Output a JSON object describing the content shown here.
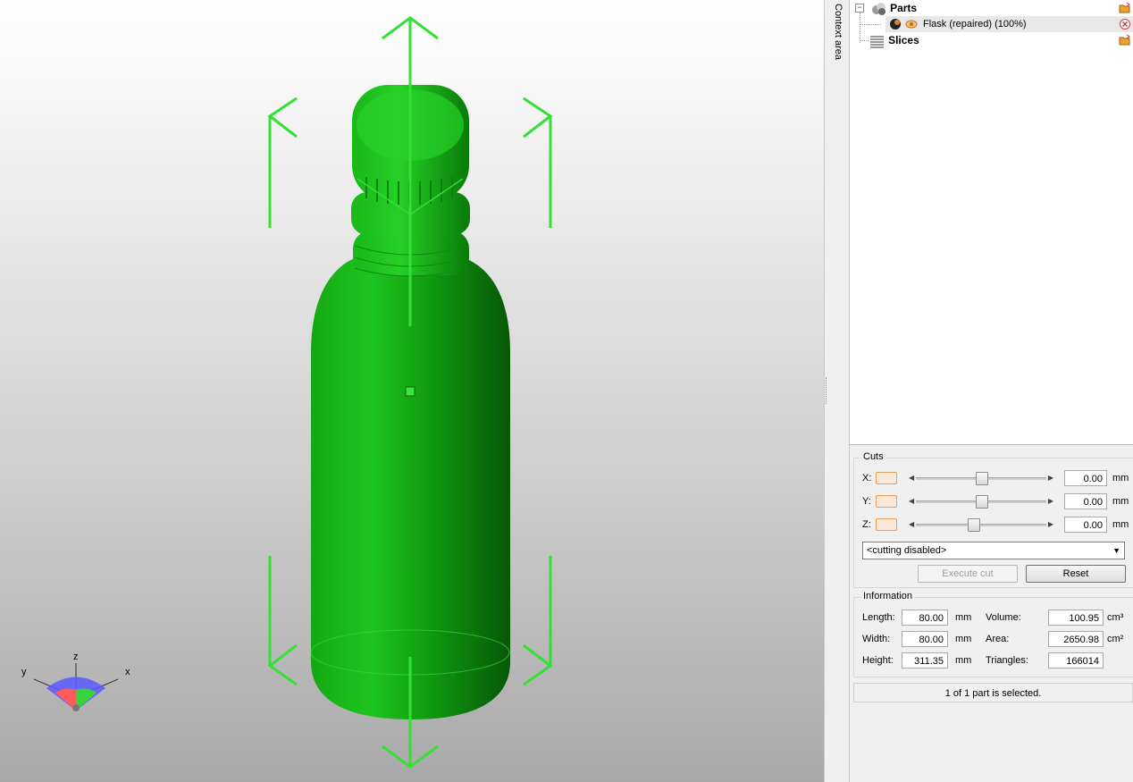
{
  "viewport": {
    "part_color": "#1ec51e",
    "gizmo_color": "#3adc3a",
    "axes": {
      "x": "x",
      "y": "y",
      "z": "z"
    }
  },
  "context_tab": {
    "label": "Context area"
  },
  "tree": {
    "parts_label": "Parts",
    "part_item": "Flask (repaired) (100%)",
    "slices_label": "Slices",
    "expander": "−"
  },
  "cuts": {
    "title": "Cuts",
    "rows": [
      {
        "axis": "X:",
        "value": "0.00",
        "unit": "mm",
        "slider": 0.5
      },
      {
        "axis": "Y:",
        "value": "0.00",
        "unit": "mm",
        "slider": 0.5
      },
      {
        "axis": "Z:",
        "value": "0.00",
        "unit": "mm",
        "slider": 0.43
      }
    ],
    "mode": "<cutting disabled>",
    "execute_label": "Execute cut",
    "reset_label": "Reset"
  },
  "information": {
    "title": "Information",
    "length_label": "Length:",
    "length": "80.00",
    "length_unit": "mm",
    "width_label": "Width:",
    "width": "80.00",
    "width_unit": "mm",
    "height_label": "Height:",
    "height": "311.35",
    "height_unit": "mm",
    "volume_label": "Volume:",
    "volume": "100.95",
    "volume_unit": "cm³",
    "area_label": "Area:",
    "area": "2650.98",
    "area_unit": "cm²",
    "triangles_label": "Triangles:",
    "triangles": "166014"
  },
  "status": "1 of 1 part is selected."
}
